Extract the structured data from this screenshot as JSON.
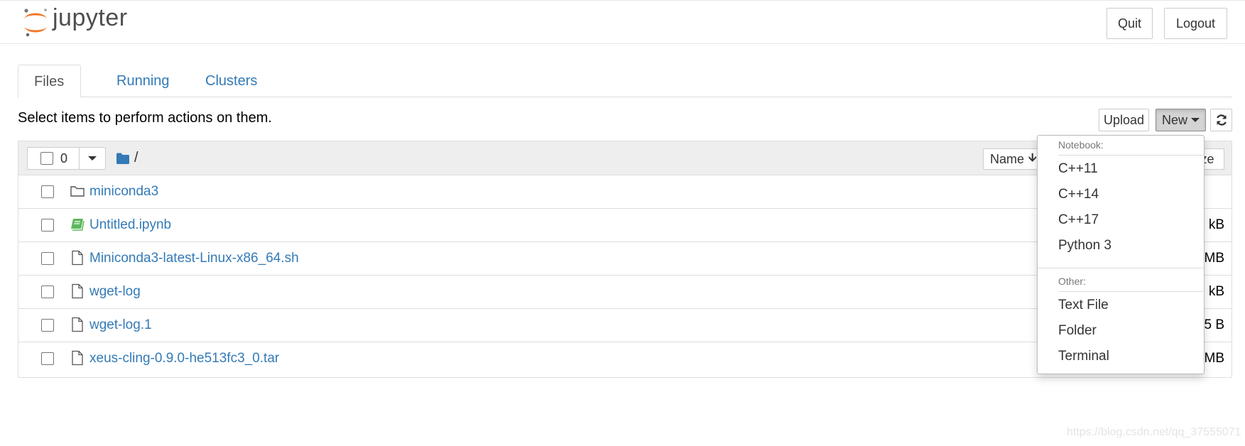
{
  "header": {
    "logo_text": "jupyter",
    "quit_label": "Quit",
    "logout_label": "Logout"
  },
  "tabs": [
    {
      "label": "Files",
      "active": true
    },
    {
      "label": "Running",
      "active": false
    },
    {
      "label": "Clusters",
      "active": false
    }
  ],
  "instructions": "Select items to perform actions on them.",
  "toolbar": {
    "upload_label": "Upload",
    "new_label": "New",
    "refresh_icon": "refresh-icon"
  },
  "list_header": {
    "selected_count": "0",
    "breadcrumb": "/",
    "sort_label": "Name",
    "size_label": "ze"
  },
  "files": [
    {
      "name": "miniconda3",
      "type": "folder",
      "size": ""
    },
    {
      "name": "Untitled.ipynb",
      "type": "notebook",
      "size": "kB"
    },
    {
      "name": "Miniconda3-latest-Linux-x86_64.sh",
      "type": "file",
      "size": "MB"
    },
    {
      "name": "wget-log",
      "type": "file",
      "size": "kB"
    },
    {
      "name": "wget-log.1",
      "type": "file",
      "size": "5 B"
    },
    {
      "name": "xeus-cling-0.9.0-he513fc3_0.tar",
      "type": "file",
      "size": "MB"
    }
  ],
  "new_menu": {
    "notebook_header": "Notebook:",
    "notebook_items": [
      "C++11",
      "C++14",
      "C++17",
      "Python 3"
    ],
    "other_header": "Other:",
    "other_items": [
      "Text File",
      "Folder",
      "Terminal"
    ]
  },
  "watermark": "https://blog.csdn.net/qq_37555071",
  "colors": {
    "link": "#337ab7",
    "logo_orange": "#f37726",
    "notebook_green": "#5cb85c",
    "header_gray": "#eeeeee"
  }
}
